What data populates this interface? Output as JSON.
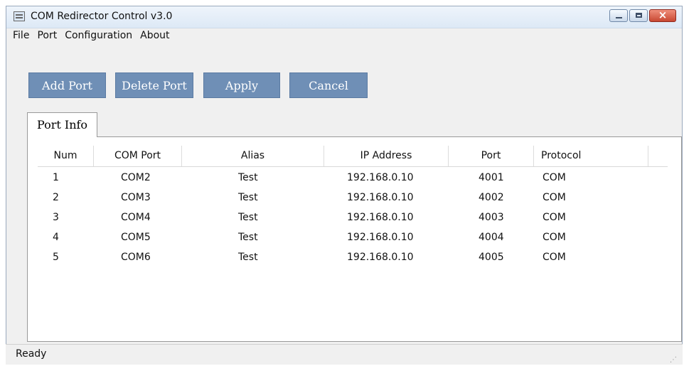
{
  "window": {
    "title": "COM Redirector Control v3.0"
  },
  "menu": [
    "File",
    "Port",
    "Configuration",
    "About"
  ],
  "toolbar": {
    "add_port": "Add Port",
    "delete_port": "Delete Port",
    "apply": "Apply",
    "cancel": "Cancel"
  },
  "tab": {
    "label": "Port Info"
  },
  "table": {
    "columns": [
      "Num",
      "COM Port",
      "Alias",
      "IP Address",
      "Port",
      "Protocol"
    ],
    "rows": [
      [
        "1",
        "COM2",
        "Test",
        "192.168.0.10",
        "4001",
        "COM"
      ],
      [
        "2",
        "COM3",
        "Test",
        "192.168.0.10",
        "4002",
        "COM"
      ],
      [
        "3",
        "COM4",
        "Test",
        "192.168.0.10",
        "4003",
        "COM"
      ],
      [
        "4",
        "COM5",
        "Test",
        "192.168.0.10",
        "4004",
        "COM"
      ],
      [
        "5",
        "COM6",
        "Test",
        "192.168.0.10",
        "4005",
        "COM"
      ]
    ]
  },
  "status": {
    "text": "Ready"
  },
  "colors": {
    "button_bg": "#6f8fb6",
    "close_button": "#c84832"
  }
}
